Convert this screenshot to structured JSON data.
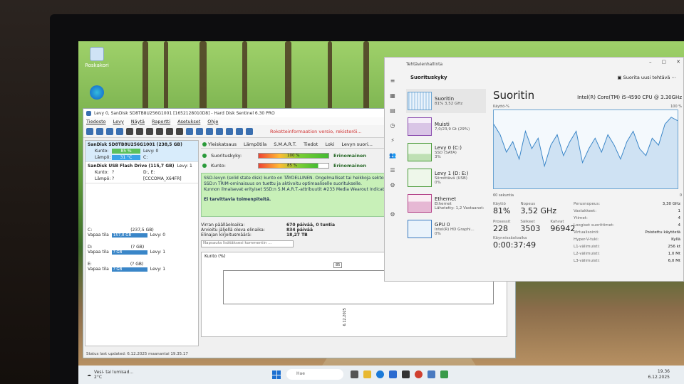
{
  "desktop": {
    "icons": [
      {
        "label": "Roskakori"
      },
      {
        "label": ""
      }
    ]
  },
  "hds": {
    "title": "Levy 0, SanDisk SD8TB8U256G1001 [1652128010D8]  -  Hard Disk Sentinel 6.30 PRO",
    "menu": [
      "Tiedosto",
      "Levy",
      "Näytä",
      "Raportti",
      "Asetukset",
      "Ohje"
    ],
    "ad_text": "Rokotteinformaation versio, rekisteröi...",
    "disks": [
      {
        "name": "SanDisk SD8TB8U256G1001 (238,5 GB)",
        "kunto_label": "Kunto:",
        "kunto": "85 %",
        "lampo_label": "Lämpö:",
        "lampo": "31 °C",
        "levy": "Levy: 0",
        "drive": "C:"
      },
      {
        "name": "SanDisk USB Flash Drive (115,7 GB)",
        "levy": "Levy: 1",
        "kunto_label": "Kunto:",
        "kunto": "?",
        "lampo_label": "Lämpö:",
        "lampo": "?",
        "extra1": "D:, E:",
        "extra2": "[CCCOMA_X64FR]"
      }
    ],
    "partitions": [
      {
        "letter": "C:",
        "size": "(237,5 GB)",
        "free_label": "Vapaa tila",
        "free": "157,8 GB",
        "levy": "Levy: 0"
      },
      {
        "letter": "D:",
        "size": "(? GB)",
        "free_label": "Vapaa tila",
        "free": "? GB",
        "levy": "Levy: 1"
      },
      {
        "letter": "E:",
        "size": "(? GB)",
        "free_label": "Vapaa tila",
        "free": "? GB",
        "levy": "Levy: 1"
      }
    ],
    "tabs": [
      "Yleiskatsaus",
      "Lämpötila",
      "S.M.A.R.T.",
      "Tiedot",
      "Loki",
      "Levyn suori..."
    ],
    "metrics": [
      {
        "label": "Suorituskyky:",
        "value": "100 %",
        "result": "Erinomainen"
      },
      {
        "label": "Kunto:",
        "value": "85 %",
        "result": "Erinomainen"
      }
    ],
    "info_lines": [
      "SSD-levyn (solid state disk) kunto on TÄYDELLINEN. Ongelmalliset tai heikkoja sektoreita ei löydy.",
      "SSD:n TRIM-ominaisuus on tuettu ja aktivoitu optimaaliselle suoritukselle.",
      "Kunnon ilmaisevat erityiset SSD:n S.M.A.R.T.-attribuutit  #233 Media Wearout Indicator"
    ],
    "info_bold": "Ei tarvittavia toimenpiteitä.",
    "stats": [
      {
        "k": "Virran päälläoloaika:",
        "v": "670 päivää, 0 tuntia"
      },
      {
        "k": "Arvioitu jäljellä oleva elinaika:",
        "v": "834 päivää"
      },
      {
        "k": "Elinajan kirjoitusmäärä:",
        "v": "18,27 TB"
      }
    ],
    "comment_placeholder": "Napsauta lisätäksesi kommentin ...",
    "chart": {
      "title": "Kunto (%)",
      "point_label": "85",
      "x_label": "6.12.2025"
    },
    "status": "Status last updated: 6.12.2025 maanantai 19.35.17"
  },
  "chart_data": {
    "type": "line",
    "title": "Kunto (%)",
    "x": [
      "6.12.2025"
    ],
    "series": [
      {
        "values": [
          85
        ]
      }
    ]
  },
  "tm": {
    "window_title": "Tehtävienhallinta",
    "section": "Suorituskyky",
    "run_task": "Suorita uusi tehtävä",
    "sidebar": [
      {
        "t1": "Suoritin",
        "t2": "81%  3,52 GHz",
        "thumb": "cpu"
      },
      {
        "t1": "Muisti",
        "t2": "7,0/23,9 Gt (29%)",
        "thumb": "mem"
      },
      {
        "t1": "Levy 0 (C:)",
        "t2": "SSD (SATA)",
        "t3": "3%",
        "thumb": "disk"
      },
      {
        "t1": "Levy 1 (D: E:)",
        "t2": "Siirrettävä (USB)",
        "t3": "0%",
        "thumb": "disk"
      },
      {
        "t1": "Ethernet",
        "t2": "Ethernet",
        "t3": "Lähetetty: 1,2 Vastaanot:",
        "thumb": "eth"
      },
      {
        "t1": "GPU 0",
        "t2": "Intel(R) HD Graphi...",
        "t3": "0%",
        "thumb": "gpu"
      }
    ],
    "heading": "Suoritin",
    "cpu_name": "Intel(R) Core(TM) i5-4590 CPU @ 3.30GHz",
    "graph_label": "Käyttö-%",
    "graph_max": "100 %",
    "graph_seconds": "60 sekuntia",
    "graph_min": "0",
    "stats": [
      {
        "l": "Käyttö",
        "v": "81%"
      },
      {
        "l": "Nopeus",
        "v": "3,52 GHz"
      }
    ],
    "stats_b": [
      {
        "l": "Prosessit",
        "v": "228"
      },
      {
        "l": "Säikeet",
        "v": "3503"
      },
      {
        "l": "Kahvat",
        "v": "96942"
      }
    ],
    "uptime_label": "Käynnissäoloaika",
    "uptime": "0:00:37:49",
    "spec": [
      {
        "k": "Perusnopeus:",
        "v": "3,30 GHz"
      },
      {
        "k": "Vastakkeet:",
        "v": "1"
      },
      {
        "k": "Ytimet:",
        "v": "4"
      },
      {
        "k": "Loogiset suorittimet:",
        "v": "4"
      },
      {
        "k": "Virtualisointi:",
        "v": "Poistettu käytöstä"
      },
      {
        "k": "Hyper-V-tuki:",
        "v": "Kyllä"
      },
      {
        "k": "L1-välimuisti:",
        "v": "256 kt"
      },
      {
        "k": "L2-välimuisti:",
        "v": "1,0 Mt"
      },
      {
        "k": "L3-välimuisti:",
        "v": "6,0 Mt"
      }
    ]
  },
  "taskbar": {
    "weather1": "Vesi- tai lumisad...",
    "weather2": "2°C",
    "search": "Hae",
    "time": "19.36",
    "date": "6.12.2025"
  }
}
